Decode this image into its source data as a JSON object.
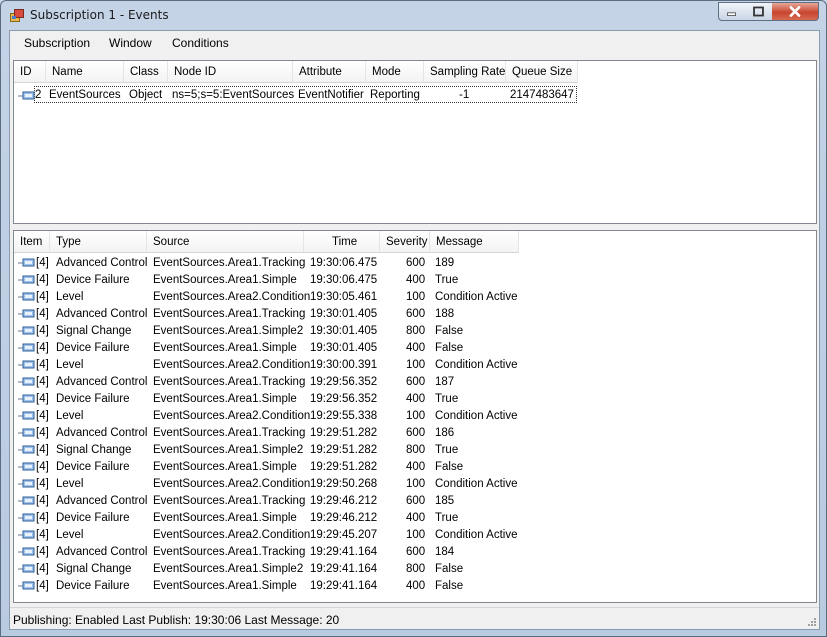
{
  "window": {
    "title": "Subscription 1 - Events"
  },
  "menu": [
    "Subscription",
    "Window",
    "Conditions"
  ],
  "monitored_items": {
    "columns": [
      "ID",
      "Name",
      "Class",
      "Node ID",
      "Attribute",
      "Mode",
      "Sampling Rate",
      "Queue Size"
    ],
    "rows": [
      {
        "id": "2",
        "name": "EventSources",
        "class": "Object",
        "node_id": "ns=5;s=5:EventSources",
        "attribute": "EventNotifier",
        "mode": "Reporting",
        "sampling_rate": "-1",
        "queue_size": "2147483647"
      }
    ]
  },
  "events": {
    "columns": [
      "Item",
      "Type",
      "Source",
      "Time",
      "Severity",
      "Message"
    ],
    "rows": [
      {
        "item": "[4]",
        "type": "Advanced Control",
        "source": "EventSources.Area1.Tracking",
        "time": "19:30:06.475",
        "severity": "600",
        "message": "189"
      },
      {
        "item": "[4]",
        "type": "Device Failure",
        "source": "EventSources.Area1.Simple",
        "time": "19:30:06.475",
        "severity": "400",
        "message": "True"
      },
      {
        "item": "[4]",
        "type": "Level",
        "source": "EventSources.Area2.Condition",
        "time": "19:30:05.461",
        "severity": "100",
        "message": "Condition Active"
      },
      {
        "item": "[4]",
        "type": "Advanced Control",
        "source": "EventSources.Area1.Tracking",
        "time": "19:30:01.405",
        "severity": "600",
        "message": "188"
      },
      {
        "item": "[4]",
        "type": "Signal Change",
        "source": "EventSources.Area1.Simple2",
        "time": "19:30:01.405",
        "severity": "800",
        "message": "False"
      },
      {
        "item": "[4]",
        "type": "Device Failure",
        "source": "EventSources.Area1.Simple",
        "time": "19:30:01.405",
        "severity": "400",
        "message": "False"
      },
      {
        "item": "[4]",
        "type": "Level",
        "source": "EventSources.Area2.Condition",
        "time": "19:30:00.391",
        "severity": "100",
        "message": "Condition Active"
      },
      {
        "item": "[4]",
        "type": "Advanced Control",
        "source": "EventSources.Area1.Tracking",
        "time": "19:29:56.352",
        "severity": "600",
        "message": "187"
      },
      {
        "item": "[4]",
        "type": "Device Failure",
        "source": "EventSources.Area1.Simple",
        "time": "19:29:56.352",
        "severity": "400",
        "message": "True"
      },
      {
        "item": "[4]",
        "type": "Level",
        "source": "EventSources.Area2.Condition",
        "time": "19:29:55.338",
        "severity": "100",
        "message": "Condition Active"
      },
      {
        "item": "[4]",
        "type": "Advanced Control",
        "source": "EventSources.Area1.Tracking",
        "time": "19:29:51.282",
        "severity": "600",
        "message": "186"
      },
      {
        "item": "[4]",
        "type": "Signal Change",
        "source": "EventSources.Area1.Simple2",
        "time": "19:29:51.282",
        "severity": "800",
        "message": "True"
      },
      {
        "item": "[4]",
        "type": "Device Failure",
        "source": "EventSources.Area1.Simple",
        "time": "19:29:51.282",
        "severity": "400",
        "message": "False"
      },
      {
        "item": "[4]",
        "type": "Level",
        "source": "EventSources.Area2.Condition",
        "time": "19:29:50.268",
        "severity": "100",
        "message": "Condition Active"
      },
      {
        "item": "[4]",
        "type": "Advanced Control",
        "source": "EventSources.Area1.Tracking",
        "time": "19:29:46.212",
        "severity": "600",
        "message": "185"
      },
      {
        "item": "[4]",
        "type": "Device Failure",
        "source": "EventSources.Area1.Simple",
        "time": "19:29:46.212",
        "severity": "400",
        "message": "True"
      },
      {
        "item": "[4]",
        "type": "Level",
        "source": "EventSources.Area2.Condition",
        "time": "19:29:45.207",
        "severity": "100",
        "message": "Condition Active"
      },
      {
        "item": "[4]",
        "type": "Advanced Control",
        "source": "EventSources.Area1.Tracking",
        "time": "19:29:41.164",
        "severity": "600",
        "message": "184"
      },
      {
        "item": "[4]",
        "type": "Signal Change",
        "source": "EventSources.Area1.Simple2",
        "time": "19:29:41.164",
        "severity": "800",
        "message": "False"
      },
      {
        "item": "[4]",
        "type": "Device Failure",
        "source": "EventSources.Area1.Simple",
        "time": "19:29:41.164",
        "severity": "400",
        "message": "False"
      }
    ]
  },
  "status": {
    "text": "Publishing:  Enabled  Last Publish:  19:30:06  Last Message:  20"
  },
  "icons": {
    "row": "monitored-item-icon",
    "app": "app-icon",
    "minimize": "minimize-icon",
    "maximize": "maximize-icon",
    "close": "close-icon",
    "grip": "resize-grip-icon"
  },
  "colors": {
    "close_button": "#c8452f",
    "title_bar": "#c4d3e6"
  }
}
